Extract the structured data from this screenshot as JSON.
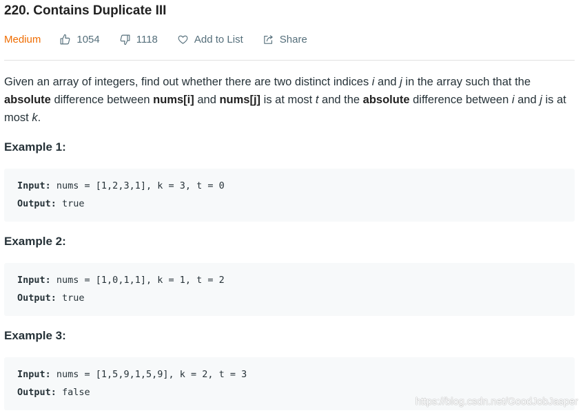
{
  "problem": {
    "title": "220. Contains Duplicate III",
    "difficulty": "Medium",
    "likes": "1054",
    "dislikes": "1118",
    "add_to_list_label": "Add to List",
    "share_label": "Share"
  },
  "description": {
    "p1_a": "Given an array of integers, find out whether there are two distinct indices ",
    "i": "i",
    "p1_b": " and ",
    "j": "j",
    "p1_c": " in the array such that the ",
    "absolute_1": "absolute",
    "p1_d": " difference between ",
    "nums_i": "nums[i]",
    "p1_e": " and ",
    "nums_j": "nums[j]",
    "p1_f": " is at most ",
    "t": "t",
    "p1_g": " and the ",
    "absolute_2": "absolute",
    "p1_h": " difference between ",
    "i2": "i",
    "p1_i": " and ",
    "j2": "j",
    "p1_j": " is at most ",
    "k": "k",
    "p1_k": "."
  },
  "examples": [
    {
      "title": "Example 1:",
      "input_label": "Input:",
      "input_value": " nums = [1,2,3,1], k = 3, t = 0",
      "output_label": "Output:",
      "output_value": " true"
    },
    {
      "title": "Example 2:",
      "input_label": "Input:",
      "input_value": " nums = [1,0,1,1], k = 1, t = 2",
      "output_label": "Output:",
      "output_value": " true"
    },
    {
      "title": "Example 3:",
      "input_label": "Input:",
      "input_value": " nums = [1,5,9,1,5,9], k = 2, t = 3",
      "output_label": "Output:",
      "output_value": " false"
    }
  ],
  "watermark": "https://blog.csdn.net/GoodJobJasper",
  "colors": {
    "difficulty": "#ef6c00",
    "code_background": "#f7f9fa",
    "text": "#263238"
  },
  "icons": [
    "thumbs-up-icon",
    "thumbs-down-icon",
    "heart-icon",
    "share-icon"
  ]
}
